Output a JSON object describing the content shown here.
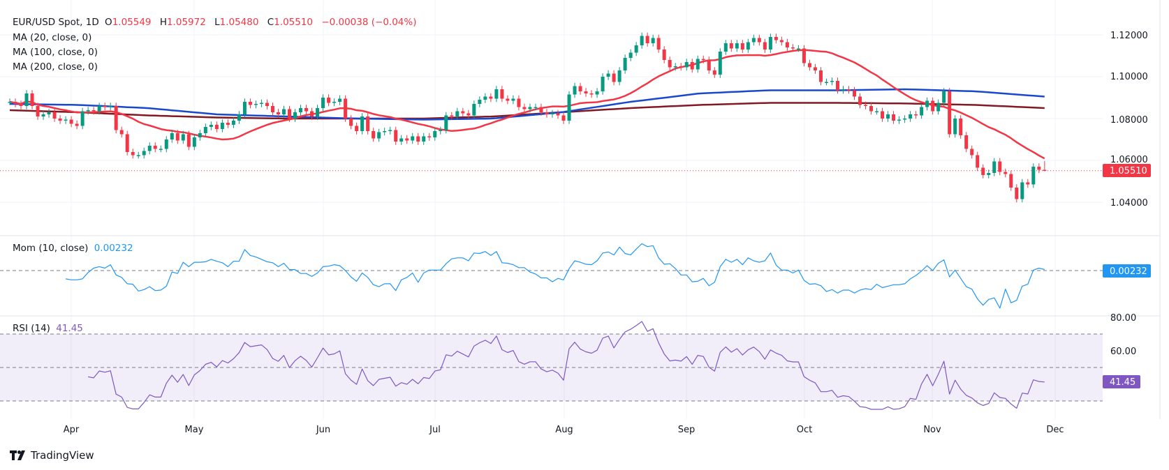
{
  "header": {
    "symbol": "EUR/USD Spot, 1D",
    "o_label": "O",
    "open": "1.05549",
    "h_label": "H",
    "high": "1.05972",
    "l_label": "L",
    "low": "1.05480",
    "c_label": "C",
    "close": "1.05510",
    "change": "−0.00038 (−0.04%)"
  },
  "legend": {
    "ma20": "MA (20, close, 0)",
    "ma100": "MA (100, close, 0)",
    "ma200": "MA (200, close, 0)",
    "mom": "Mom (10, close)",
    "mom_value": "0.00232",
    "rsi": "RSI (14)",
    "rsi_value": "41.45"
  },
  "price_axis": {
    "ticks": [
      "1.12000",
      "1.10000",
      "1.08000",
      "1.06000",
      "1.04000"
    ],
    "last_price_label": "1.05510"
  },
  "rsi_axis": {
    "ticks": [
      "80.00",
      "60.00"
    ]
  },
  "x_axis": {
    "ticks": [
      "Apr",
      "May",
      "Jun",
      "Jul",
      "Aug",
      "Sep",
      "Oct",
      "Nov",
      "Dec"
    ]
  },
  "brand": {
    "name": "TradingView"
  },
  "colors": {
    "up": "#089981",
    "down": "#F23645",
    "ma20": "#F23645",
    "ma100": "#1848CC",
    "ma200": "#801922",
    "mom": "#2196F3",
    "rsi": "#7E57C2"
  },
  "chart_data": {
    "type": "candlestick",
    "title": "EUR/USD Spot, 1D",
    "interval": "1D",
    "last_bar": {
      "open": 1.05549,
      "high": 1.05972,
      "low": 1.0548,
      "close": 1.0551
    },
    "y_range": [
      1.028,
      1.126
    ],
    "x_ticks": [
      "Apr",
      "May",
      "Jun",
      "Jul",
      "Aug",
      "Sep",
      "Oct",
      "Nov",
      "Dec"
    ],
    "closes": [
      1.088,
      1.087,
      1.086,
      1.092,
      1.086,
      1.081,
      1.082,
      1.083,
      1.08,
      1.079,
      1.0795,
      1.0775,
      1.0765,
      1.0835,
      1.084,
      1.0835,
      1.086,
      1.0855,
      1.086,
      1.0745,
      1.0725,
      1.064,
      1.0625,
      1.0625,
      1.0645,
      1.067,
      1.0655,
      1.0655,
      1.07,
      1.073,
      1.0695,
      1.0725,
      1.0665,
      1.071,
      1.073,
      1.076,
      1.077,
      1.075,
      1.078,
      1.077,
      1.079,
      1.082,
      1.088,
      1.0865,
      1.087,
      1.0875,
      1.086,
      1.083,
      1.082,
      1.0845,
      1.08,
      1.083,
      1.085,
      1.0835,
      1.081,
      1.085,
      1.09,
      1.0875,
      1.088,
      1.0895,
      1.08,
      1.0765,
      1.074,
      1.081,
      1.074,
      1.0705,
      1.0735,
      1.074,
      1.0745,
      1.069,
      1.0705,
      1.0695,
      1.0715,
      1.069,
      1.0715,
      1.071,
      1.074,
      1.0745,
      1.0815,
      1.081,
      1.0835,
      1.0825,
      1.0815,
      1.087,
      1.089,
      1.0905,
      1.0895,
      1.094,
      1.0895,
      1.0885,
      1.0895,
      1.0855,
      1.0845,
      1.0855,
      1.0855,
      1.083,
      1.082,
      1.0825,
      1.0815,
      1.079,
      1.0915,
      1.0955,
      1.093,
      1.092,
      1.0915,
      1.093,
      1.1,
      1.1015,
      1.0975,
      1.103,
      1.109,
      1.1115,
      1.115,
      1.1195,
      1.116,
      1.1185,
      1.113,
      1.108,
      1.1045,
      1.105,
      1.1045,
      1.107,
      1.1035,
      1.1085,
      1.108,
      1.103,
      1.101,
      1.112,
      1.116,
      1.1135,
      1.116,
      1.113,
      1.1165,
      1.1185,
      1.1165,
      1.113,
      1.119,
      1.1175,
      1.1165,
      1.114,
      1.1135,
      1.1135,
      1.1065,
      1.1045,
      1.103,
      1.0975,
      1.0975,
      1.098,
      1.0935,
      1.094,
      1.0935,
      1.0905,
      1.0865,
      1.086,
      1.0835,
      1.0835,
      1.08,
      1.082,
      1.079,
      1.0795,
      1.08,
      1.082,
      1.0815,
      1.0855,
      1.0885,
      1.0835,
      1.0875,
      1.093,
      1.0725,
      1.08,
      1.072,
      1.0655,
      1.0625,
      1.0565,
      1.053,
      1.054,
      1.0595,
      1.0545,
      1.0535,
      1.047,
      1.0415,
      1.0495,
      1.0485,
      1.057,
      1.0555,
      1.0551
    ],
    "ma100": [
      1.087,
      1.0865,
      1.085,
      1.082,
      1.081,
      1.08,
      1.0795,
      1.08,
      1.083,
      1.088,
      1.092,
      1.0935,
      1.0935,
      1.094,
      1.093,
      1.0905
    ],
    "ma200": [
      1.084,
      1.083,
      1.0815,
      1.0805,
      1.08,
      1.08,
      1.08,
      1.081,
      1.083,
      1.085,
      1.0865,
      1.0875,
      1.0875,
      1.0872,
      1.0865,
      1.085
    ],
    "mom_last": 0.00232,
    "rsi_last": 41.45,
    "rsi_levels": [
      70,
      50,
      30
    ]
  }
}
